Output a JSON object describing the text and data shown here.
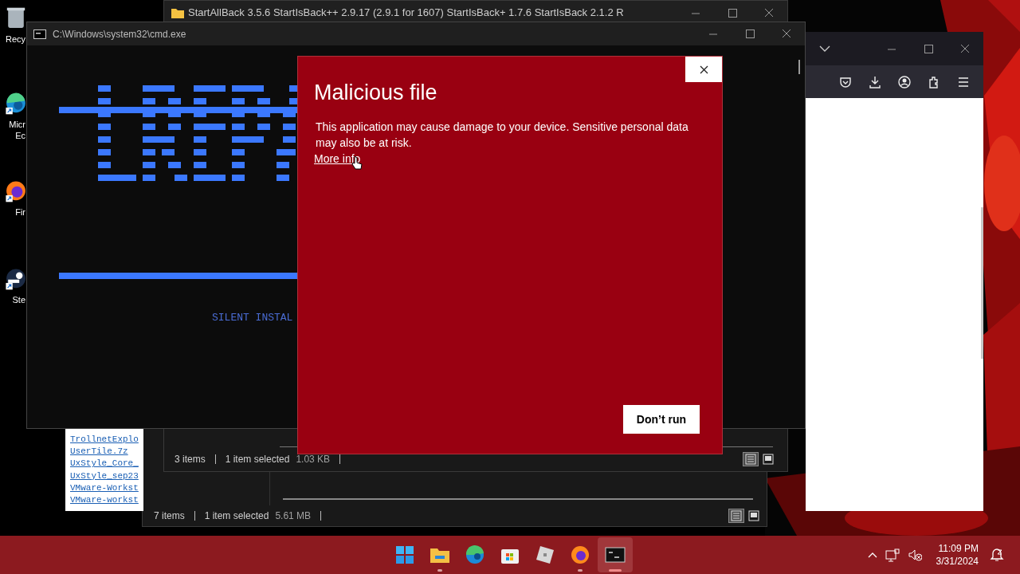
{
  "desktop_icons": [
    {
      "kind": "recycle",
      "lines": [
        "Recy"
      ]
    },
    {
      "kind": "edge",
      "lines": [
        "Micr",
        "Ec"
      ]
    },
    {
      "kind": "firefox",
      "lines": [
        "Fir"
      ]
    },
    {
      "kind": "steam",
      "lines": [
        "Ste"
      ]
    }
  ],
  "explorer_back": {
    "title": "StartAllBack 3.5.6 StartIsBack++ 2.9.17 (2.9.1 for 1607) StartIsBack+ 1.7.6 StartIsBack 2.1.2 R",
    "status": {
      "count": "3 items",
      "selection": "1 item selected",
      "size": "1.03 KB"
    },
    "view_buttons": [
      {
        "kind": "details",
        "selected": true
      },
      {
        "kind": "tiles",
        "selected": false
      }
    ]
  },
  "explorer_front": {
    "status": {
      "count": "7 items",
      "selection": "1 item selected",
      "size": "5.61 MB"
    },
    "view_buttons": [
      {
        "kind": "details",
        "selected": true
      },
      {
        "kind": "tiles",
        "selected": false
      }
    ]
  },
  "file_listing": [
    "TrollnetExplo",
    "UserTile.7z",
    "UxStyle_Core_",
    "UxStyle_sep23",
    "VMware-Workst",
    "VMware-workst"
  ],
  "cmd": {
    "title": "C:\\Windows\\system32\\cmd.exe",
    "caption": "SILENT INSTAL"
  },
  "dialog": {
    "title": "Malicious file",
    "message": "This application may cause damage to your device. Sensitive personal data may also be at risk.",
    "link": "More info",
    "button": "Don’t run"
  },
  "taskbar": {
    "apps": [
      {
        "kind": "start",
        "running": false,
        "selected": false
      },
      {
        "kind": "explorer",
        "running": true,
        "selected": false
      },
      {
        "kind": "edge",
        "running": false,
        "selected": false
      },
      {
        "kind": "store",
        "running": false,
        "selected": false
      },
      {
        "kind": "roblox",
        "running": false,
        "selected": false
      },
      {
        "kind": "firefox",
        "running": true,
        "selected": false
      },
      {
        "kind": "terminal",
        "running": true,
        "selected": true
      }
    ],
    "time": "11:09 PM",
    "date": "3/31/2024"
  }
}
